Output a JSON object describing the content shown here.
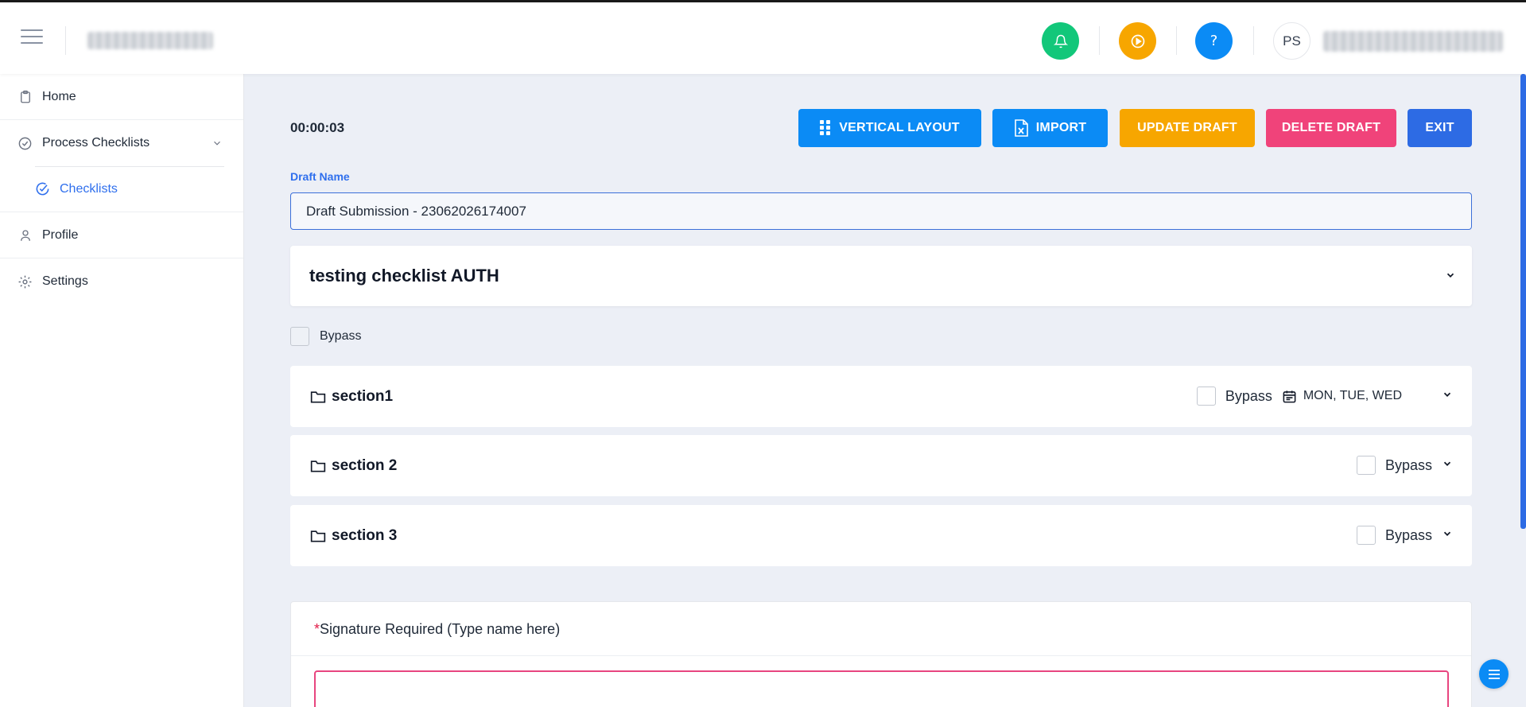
{
  "header": {
    "user_initials": "PS",
    "help_glyph": "?",
    "icons": {
      "notifications": "bell-icon",
      "media": "play-circle-icon",
      "help": "help-icon",
      "menu": "hamburger-icon"
    }
  },
  "sidebar": {
    "items": [
      {
        "label": "Home",
        "icon": "clipboard-icon"
      },
      {
        "label": "Process Checklists",
        "icon": "check-circle-icon"
      },
      {
        "label": "Checklists",
        "icon": "check-circle-icon"
      },
      {
        "label": "Profile",
        "icon": "user-icon"
      },
      {
        "label": "Settings",
        "icon": "gear-icon"
      }
    ]
  },
  "toolbar": {
    "timer": "00:00:03",
    "vertical_layout_label": "VERTICAL LAYOUT",
    "import_label": "IMPORT",
    "update_draft_label": "UPDATE DRAFT",
    "delete_draft_label": "DELETE DRAFT",
    "exit_label": "EXIT"
  },
  "draft": {
    "label": "Draft Name",
    "value": "Draft Submission - 23062026174007"
  },
  "checklist": {
    "title": "testing checklist AUTH",
    "bypass_label": "Bypass",
    "sections": [
      {
        "name": "section1",
        "bypass_label": "Bypass",
        "days": "MON, TUE, WED"
      },
      {
        "name": "section 2",
        "bypass_label": "Bypass"
      },
      {
        "name": "section 3",
        "bypass_label": "Bypass"
      }
    ]
  },
  "signature": {
    "required_mark": "*",
    "label": "Signature Required (Type name here)"
  },
  "colors": {
    "primary": "#0b8bf5",
    "warning": "#f7a600",
    "danger": "#f0437a",
    "exit": "#2d6be4",
    "success": "#12c77a",
    "link": "#2f6fed"
  }
}
